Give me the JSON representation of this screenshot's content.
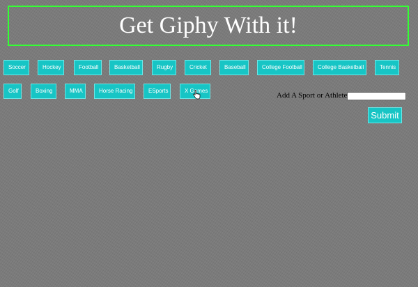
{
  "header": {
    "title": "Get Giphy With it!"
  },
  "sports_buttons": [
    "Soccer",
    "Hockey",
    "Football",
    "Basketball",
    "Rugby",
    "Cricket",
    "Baseball",
    "College Football",
    "College Basketball",
    "Tennis",
    "Golf",
    "Boxing",
    "MMA",
    "Horse Racing",
    "ESports",
    "X Games"
  ],
  "form": {
    "label": "Add A Sport or Athlete",
    "input_value": "",
    "submit_label": "Submit"
  },
  "colors": {
    "button_bg": "#17c5c5",
    "header_border": "#33ff33",
    "background": "#7a7a7a"
  },
  "icons": {
    "cursor": "pointer-hand-cursor"
  }
}
